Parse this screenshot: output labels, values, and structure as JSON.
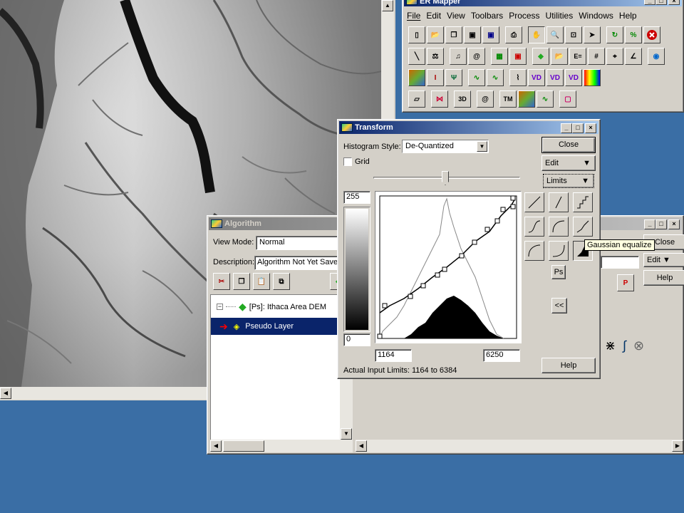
{
  "image_window": {
    "alt": "Ithaca Area DEM grayscale terrain"
  },
  "ermapper": {
    "title": "ER Mapper",
    "menu": [
      "File",
      "Edit",
      "View",
      "Toolbars",
      "Process",
      "Utilities",
      "Windows",
      "Help"
    ]
  },
  "transform": {
    "title": "Transform",
    "histogram_style_label": "Histogram Style:",
    "histogram_style_value": "De-Quantized",
    "grid_label": "Grid",
    "grid_checked": false,
    "close_label": "Close",
    "edit_label": "Edit",
    "limits_label": "Limits",
    "help_label": "Help",
    "out_max": "255",
    "out_min": "0",
    "in_min": "1164",
    "in_max": "6250",
    "actual_limits": "Actual Input Limits: 1164 to 6384",
    "tooltip": "Gaussian equalize",
    "ps_label": "Ps",
    "collapse_label": "<<"
  },
  "algorithm": {
    "title": "Algorithm",
    "view_mode_label": "View Mode:",
    "view_mode_value": "Normal",
    "description_label": "Description:",
    "description_value": "Algorithm Not Yet Saved",
    "tree": [
      {
        "label": "[Ps]: Ithaca Area DEM"
      },
      {
        "label": "Pseudo Layer"
      }
    ],
    "close_label": "Close",
    "edit_label": "Edit",
    "help_label": "Help"
  }
}
